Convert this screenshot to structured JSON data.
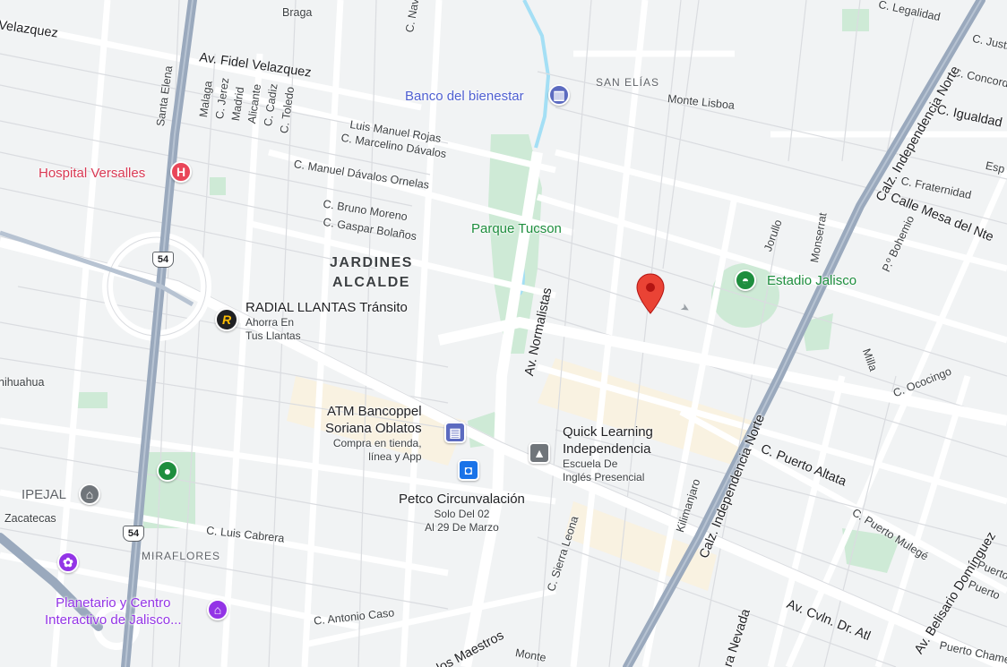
{
  "map": {
    "neighborhoods": {
      "jardines_alcalde": "JARDINES\nALCALDE",
      "san_elias": "SAN ELÍAS",
      "miraflores": "MIRAFLORES"
    },
    "streets": {
      "braga": "Braga",
      "c_navarra": "C. Navarra",
      "velazquez_left": "Velazquez",
      "fidel_velazquez": "Av. Fidel Velazquez",
      "santa_elena": "Santa Elena",
      "malaga": "Malaga",
      "c_jerez": "C. Jerez",
      "madrid": "Madrid",
      "alicante": "Alicante",
      "c_cadiz": "C. Cadiz",
      "c_toledo": "C. Toledo",
      "luis_manuel_rojas": "Luis Manuel Rojas",
      "marcelino_davalos": "C. Marcelino Dávalos",
      "manuel_davalos_ornelas": "C. Manuel Dávalos Ornelas",
      "bruno_moreno": "C. Bruno Moreno",
      "gaspar_bolanos": "C. Gaspar Bolaños",
      "monte_lisboa": "Monte Lisboa",
      "c_legalidad": "C. Legalidad",
      "c_justi": "C. Justi",
      "c_concord": "C. Concord",
      "c_igualdad": "C. Igualdad",
      "calz_independencia_norte_top": "Calz. Independencia Norte",
      "esp": "Esp",
      "c_fraternidad": "C. Fraternidad",
      "calle_mesa_del_nte": "Calle Mesa del Nte",
      "p_bohemio": "P.º Bohemio",
      "jorullo": "Jorullo",
      "monserrat": "Monserrat",
      "milla": "Milla",
      "c_ococingo": "C. Ococingo",
      "av_normalistas": "Av. Normalistas",
      "chihuahua": "nihuahua",
      "zacatecas": "Zacatecas",
      "c_luis_cabrera": "C. Luis Cabrera",
      "c_antonio_caso": "C. Antonio Caso",
      "de_los_maestros": "de los Maestros",
      "monte": "Monte",
      "c_sierra_leona": "C. Sierra Leona",
      "kilimanjaro": "Kilimanjaro",
      "calz_independencia_norte_bottom": "Calz. Independencia Norte",
      "c_puerto_altata": "C. Puerto Altata",
      "c_puerto_mulege": "C. Puerto Mulegé",
      "av_belisario_dominguez": "Av. Belisario Domínguez",
      "puerto_right_1": "Puerto",
      "puerto_right_2": "Puerto",
      "puerto_chame": "Puerto Chame",
      "av_cvln_dr_atl": "Av. Cvln. Dr. Atl",
      "sierra_nevada": "ra Nevada"
    },
    "route_shield": "54",
    "pois": {
      "banco": {
        "name": "Banco del bienestar",
        "color": "#4e5fd1"
      },
      "hospital": {
        "name": "Hospital Versalles",
        "icon": "H",
        "color": "#e94658"
      },
      "parque": {
        "name": "Parque Tucson",
        "color": "#1e8e3e"
      },
      "estadio": {
        "name": "Estadio Jalisco",
        "color": "#1e8e3e"
      },
      "radial": {
        "name": "RADIAL LLANTAS Tránsito",
        "sub": "Ahorra En\nTus Llantas",
        "icon": "R"
      },
      "atm": {
        "name": "ATM Bancoppel\nSoriana Oblatos",
        "sub": "Compra en tienda,\nlínea y App",
        "color": "#5c6bc0"
      },
      "petco": {
        "name": "Petco Circunvalación",
        "sub": "Solo Del 02\nAl 29 De Marzo",
        "color": "#1a73e8"
      },
      "quick": {
        "name": "Quick Learning\nIndependencia",
        "sub": "Escuela De\nInglés Presencial",
        "color": "#70757a"
      },
      "ipejal": {
        "name": "IPEJAL",
        "color": "#70757a"
      },
      "planetario": {
        "name": "Planetario y Centro\nInteractivo de Jalisco...",
        "color": "#9334e6"
      }
    },
    "colors": {
      "background": "#f1f3f4",
      "road": "#ffffff",
      "highway": "#9aa9bd",
      "park": "#ceead6",
      "water": "#a4dff5",
      "pin": "#ea4335"
    }
  }
}
